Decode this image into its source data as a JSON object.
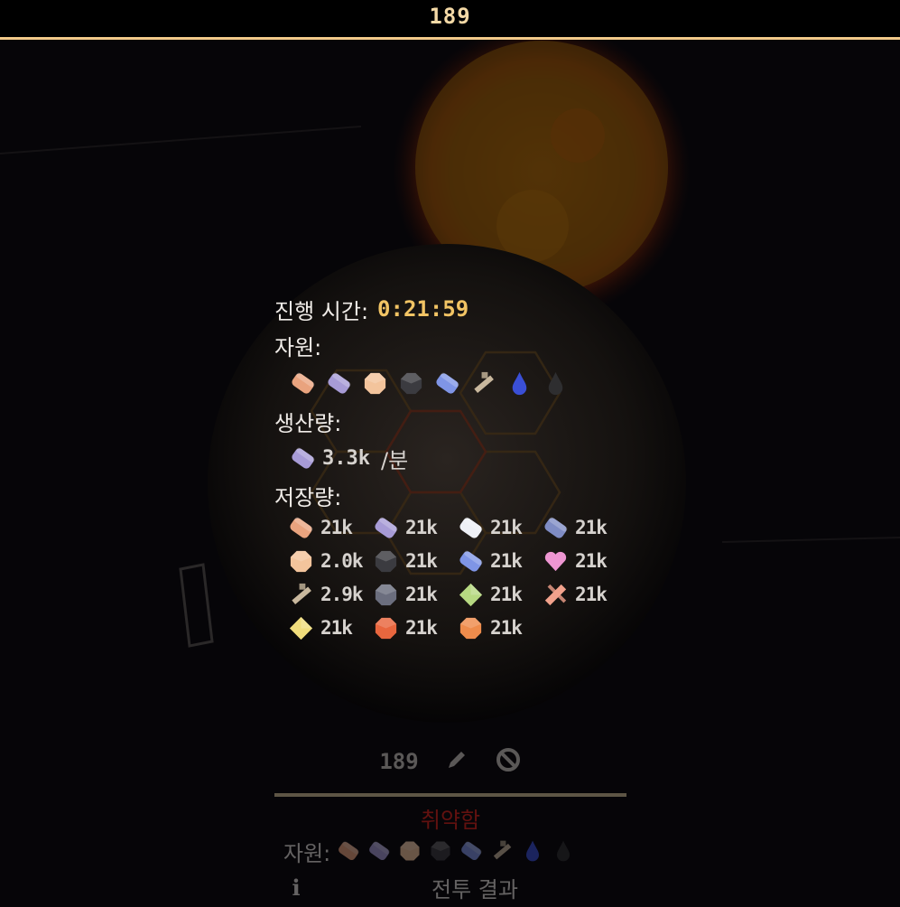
{
  "top_bar": {
    "value": "189"
  },
  "tooltip": {
    "time_label": "진행 시간:",
    "time_value": "0:21:59",
    "resources_label": "자원:",
    "resources": [
      {
        "icon": "copper-bar-icon",
        "color": "#e9a37e"
      },
      {
        "icon": "lead-bar-icon",
        "color": "#a79bd6"
      },
      {
        "icon": "sand-icon",
        "color": "#f3c49c"
      },
      {
        "icon": "coal-icon",
        "color": "#3b3b40"
      },
      {
        "icon": "titanium-icon",
        "color": "#7f95e6"
      },
      {
        "icon": "scrap-icon",
        "color": "#c9b89e"
      },
      {
        "icon": "water-drop-icon",
        "color": "#3a4fd6"
      },
      {
        "icon": "oil-drop-icon",
        "color": "#2e2e30"
      }
    ],
    "production_label": "생산량:",
    "production": [
      {
        "icon": "lead-bar-icon",
        "color": "#a79bd6",
        "value": "3.3k",
        "unit": "/분"
      }
    ],
    "storage_label": "저장량:",
    "storage": [
      {
        "icon": "copper-bar-icon",
        "color": "#e9a37e",
        "value": "21k"
      },
      {
        "icon": "lead-bar-icon",
        "color": "#a79bd6",
        "value": "21k"
      },
      {
        "icon": "metaglass-icon",
        "color": "#eef0f6",
        "value": "21k"
      },
      {
        "icon": "graphite-icon",
        "color": "#7f8cc4",
        "value": "21k"
      },
      {
        "icon": "sand-icon",
        "color": "#f3c49c",
        "value": "2.0k"
      },
      {
        "icon": "coal-icon",
        "color": "#3b3b40",
        "value": "21k"
      },
      {
        "icon": "titanium-icon",
        "color": "#7f95e6",
        "value": "21k"
      },
      {
        "icon": "thorium-icon",
        "color": "#ee96d2",
        "value": "21k"
      },
      {
        "icon": "scrap-icon",
        "color": "#c9b89e",
        "value": "2.9k"
      },
      {
        "icon": "silicon-icon",
        "color": "#6b6e7e",
        "value": "21k"
      },
      {
        "icon": "plastanium-icon",
        "color": "#b7d982",
        "value": "21k"
      },
      {
        "icon": "phase-fabric-icon",
        "color": "#f2a28c",
        "value": "21k"
      },
      {
        "icon": "surge-alloy-icon",
        "color": "#f1dd7c",
        "value": "21k"
      },
      {
        "icon": "spore-pod-icon",
        "color": "#e8663e",
        "value": "21k"
      },
      {
        "icon": "pyratite-icon",
        "color": "#ef8c4c",
        "value": "21k"
      }
    ]
  },
  "sector_panel": {
    "number": "189",
    "warning": "취약함",
    "resources_label": "자원:",
    "battle_result_label": "전투 결과"
  }
}
